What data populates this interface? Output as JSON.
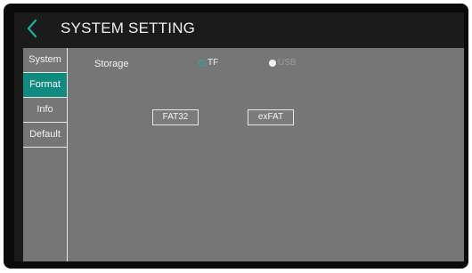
{
  "header": {
    "title": "SYSTEM SETTING",
    "back_icon": "chevron-left-icon"
  },
  "sidebar": {
    "items": [
      {
        "label": "System",
        "active": false
      },
      {
        "label": "Format",
        "active": true
      },
      {
        "label": "Info",
        "active": false
      },
      {
        "label": "Default",
        "active": false
      }
    ]
  },
  "format": {
    "storage_label": "Storage",
    "options": [
      {
        "label": "TF",
        "selected": true,
        "enabled": true
      },
      {
        "label": "USB",
        "selected": false,
        "enabled": false
      }
    ],
    "buttons": {
      "fat32": "FAT32",
      "exfat": "exFAT"
    }
  },
  "colors": {
    "accent": "#0f8a7f",
    "panel": "#767676",
    "background": "#1b1b1b"
  }
}
